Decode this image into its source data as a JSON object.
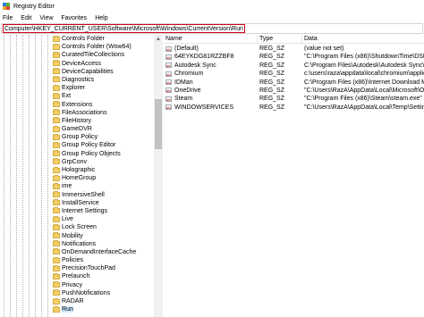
{
  "window": {
    "title": "Registry Editor"
  },
  "menu": [
    "File",
    "Edit",
    "View",
    "Favorites",
    "Help"
  ],
  "address": "Computer\\HKEY_CURRENT_USER\\Software\\Microsoft\\Windows\\CurrentVersion\\Run",
  "tree": {
    "items": [
      "Controls Folder",
      "Controls Folder (Wow64)",
      "CuratedTileCollections",
      "DeviceAccess",
      "DeviceCapabilities",
      "Diagnostics",
      "Explorer",
      "Ext",
      "Extensions",
      "FileAssociations",
      "FileHistory",
      "GameDVR",
      "Group Policy",
      "Group Policy Editor",
      "Group Policy Objects",
      "GrpConv",
      "Holographic",
      "HomeGroup",
      "ime",
      "ImmersiveShell",
      "InstallService",
      "Internet Settings",
      "Live",
      "Lock Screen",
      "Mobility",
      "Notifications",
      "OnDemandInterfaceCache",
      "Policies",
      "PrecisionTouchPad",
      "Prelaunch",
      "Privacy",
      "PushNotifications",
      "RADAR",
      "Run"
    ],
    "selected": "Run"
  },
  "list": {
    "columns": {
      "name": "Name",
      "type": "Type",
      "data": "Data"
    },
    "rows": [
      {
        "name": "(Default)",
        "type": "REG_SZ",
        "data": "(value not set)"
      },
      {
        "name": "64EYKDG81RZZBF8",
        "type": "REG_SZ",
        "data": "\"C:\\Program Files (x86)\\ShutdownTime\\DSN3"
      },
      {
        "name": "Autodesk Sync",
        "type": "REG_SZ",
        "data": "C:\\Program Files\\Autodesk\\Autodesk Sync\\A"
      },
      {
        "name": "Chromium",
        "type": "REG_SZ",
        "data": "c:\\users\\raza\\appdata\\local\\chromium\\applic"
      },
      {
        "name": "IDMan",
        "type": "REG_SZ",
        "data": "C:\\Program Files (x86)\\Internet Download Ma"
      },
      {
        "name": "OneDrive",
        "type": "REG_SZ",
        "data": "\"C:\\Users\\RazA\\AppData\\Local\\Microsoft\\One"
      },
      {
        "name": "Steam",
        "type": "REG_SZ",
        "data": "\"C:\\Program Files (x86)\\Steam\\steam.exe\" -"
      },
      {
        "name": "WINDOWSERVICES",
        "type": "REG_SZ",
        "data": "\"C:\\Users\\RazA\\AppData\\Local\\Temp\\Setting"
      }
    ]
  }
}
